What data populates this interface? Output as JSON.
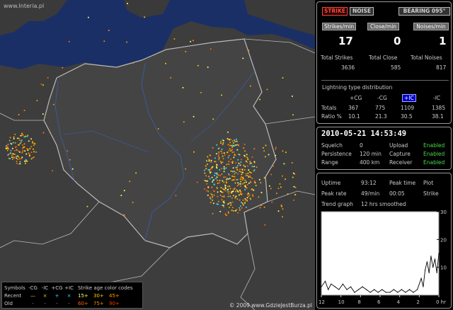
{
  "map": {
    "watermark": "www.Interia.pl",
    "copyright": "© 2009 www.GdzieJestBurza.pl"
  },
  "legend": {
    "title_symbols": "Symbols",
    "headers": [
      "-CG",
      "-IC",
      "+CG",
      "+IC"
    ],
    "age_title": "Strike age color codes",
    "row_recent_label": "Recent",
    "row_old_label": "Old",
    "recent_symbols": [
      "—",
      "×",
      "+",
      "×"
    ],
    "old_symbols": [
      "·",
      "·",
      "·",
      "·"
    ],
    "age_recent": [
      "15+",
      "30+",
      "45+"
    ],
    "age_old": [
      "60+",
      "75+",
      "90+"
    ],
    "colors": {
      "c15": "#ffff66",
      "c30": "#ffcc00",
      "c45": "#ff9900",
      "c60": "#ff6600",
      "c75": "#ff8800",
      "c90": "#ff3300"
    }
  },
  "controls": {
    "strike": "STRIKE",
    "noise": "NOISE",
    "bearing": "BEARING 095°"
  },
  "stats": {
    "strikes_label": "Strikes/min",
    "close_label": "Close/min",
    "noises_label": "Noises/min",
    "strikes_val": "17",
    "close_val": "0",
    "noises_val": "1",
    "total_strikes_label": "Total Strikes",
    "total_close_label": "Total Close",
    "total_noises_label": "Total Noises",
    "total_strikes": "3636",
    "total_close": "585",
    "total_noises": "817"
  },
  "distribution": {
    "title": "Lightning type distribution",
    "headers": [
      "+CG",
      "-CG",
      "+IC",
      "-IC"
    ],
    "totals_label": "Totals",
    "totals": [
      "367",
      "775",
      "1109",
      "1385"
    ],
    "ratio_label": "Ratio %",
    "ratio": [
      "10.1",
      "21.3",
      "30.5",
      "38.1"
    ]
  },
  "settings": {
    "datetime": "2010-05-21 14:53:49",
    "squelch_label": "Squelch",
    "squelch": "0",
    "persistence_label": "Persistence",
    "persistence": "120 min",
    "range_label": "Range",
    "range": "400 km",
    "upload_label": "Upload",
    "upload": "Enabled",
    "capture_label": "Capture",
    "capture": "Enabled",
    "receiver_label": "Receiver",
    "receiver": "Enabled"
  },
  "info": {
    "uptime_label": "Uptime",
    "uptime": "93:12",
    "peak_time_label": "Peak time",
    "plot_label": "Plot",
    "peak_rate_label": "Peak rate",
    "peak_rate": "49/min",
    "peak_time": "00:05",
    "plot": "Strike",
    "trend_label": "Trend graph",
    "trend": "12 hrs smoothed"
  },
  "chart_data": {
    "type": "line",
    "title": "",
    "xlabel": "",
    "ylabel": "",
    "x_ticks": [
      "12",
      "10",
      "8",
      "6",
      "4",
      "2",
      "0 hr"
    ],
    "y_ticks": [
      "30",
      "20",
      "10"
    ],
    "xlim": [
      12,
      0
    ],
    "ylim": [
      0,
      30
    ],
    "x": [
      12,
      11.6,
      11.3,
      11,
      10.6,
      10.2,
      9.8,
      9.4,
      9,
      8.6,
      8.2,
      7.8,
      7.4,
      7,
      6.6,
      6.2,
      5.8,
      5.4,
      5,
      4.6,
      4.2,
      3.8,
      3.4,
      3,
      2.6,
      2.2,
      1.8,
      1.6,
      1.4,
      1.2,
      1.0,
      0.8,
      0.6,
      0.4,
      0.2,
      0
    ],
    "values": [
      3,
      5,
      2,
      4,
      3,
      2,
      4,
      2,
      3,
      1,
      2,
      3,
      2,
      1,
      2,
      1,
      2,
      1,
      1,
      2,
      1,
      2,
      1,
      2,
      1,
      2,
      6,
      3,
      9,
      12,
      8,
      14,
      10,
      13,
      8,
      15
    ],
    "grid": false
  }
}
